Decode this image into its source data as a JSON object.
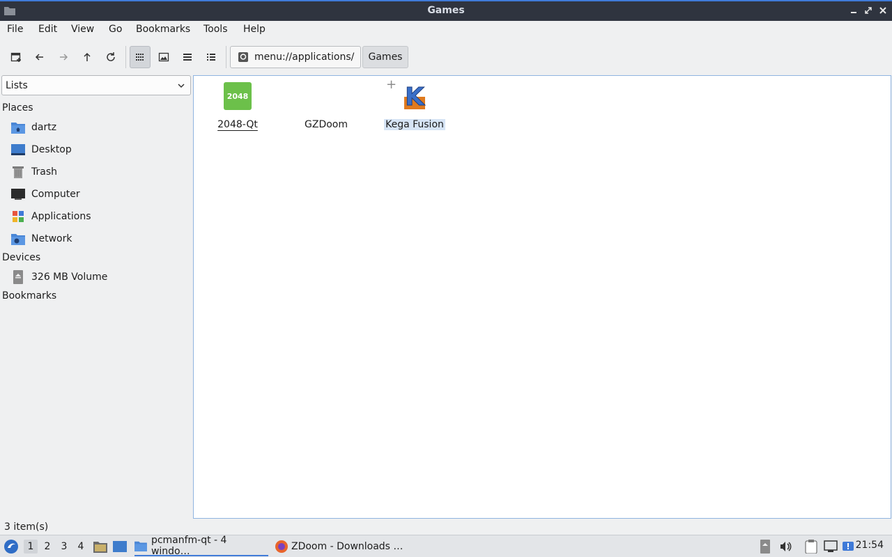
{
  "window": {
    "title": "Games"
  },
  "menu": [
    "File",
    "Edit",
    "View",
    "Go",
    "Bookmarks",
    "Tools",
    "Help"
  ],
  "toolbar": {
    "path": "menu://applications/",
    "crumb": "Games"
  },
  "sidebar": {
    "selector": "Lists",
    "places_header": "Places",
    "places": [
      {
        "label": "dartz",
        "icon": "home-folder-icon"
      },
      {
        "label": "Desktop",
        "icon": "desktop-icon"
      },
      {
        "label": "Trash",
        "icon": "trash-icon"
      },
      {
        "label": "Computer",
        "icon": "computer-icon"
      },
      {
        "label": "Applications",
        "icon": "applications-icon"
      },
      {
        "label": "Network",
        "icon": "network-icon"
      }
    ],
    "devices_header": "Devices",
    "devices": [
      {
        "label": "326 MB Volume",
        "icon": "drive-icon"
      }
    ],
    "bookmarks_header": "Bookmarks"
  },
  "files": [
    {
      "label": "2048-Qt",
      "icon": "2048-icon",
      "icon_text": "2048"
    },
    {
      "label": "GZDoom",
      "icon": "gzdoom-icon"
    },
    {
      "label": "Kega Fusion",
      "icon": "kega-fusion-icon",
      "icon_text": "K"
    }
  ],
  "status": "3 item(s)",
  "taskbar": {
    "workspaces": [
      "1",
      "2",
      "3",
      "4"
    ],
    "tasks": [
      {
        "label": "pcmanfm-qt - 4 windo…"
      },
      {
        "label": "ZDoom - Downloads …"
      }
    ],
    "clock": "21:54"
  },
  "colors": {
    "titlebar": "#2f343f",
    "accent": "#3f7ad8",
    "green_2048": "#6cc04a",
    "folder_blue": "#4a86d6"
  }
}
